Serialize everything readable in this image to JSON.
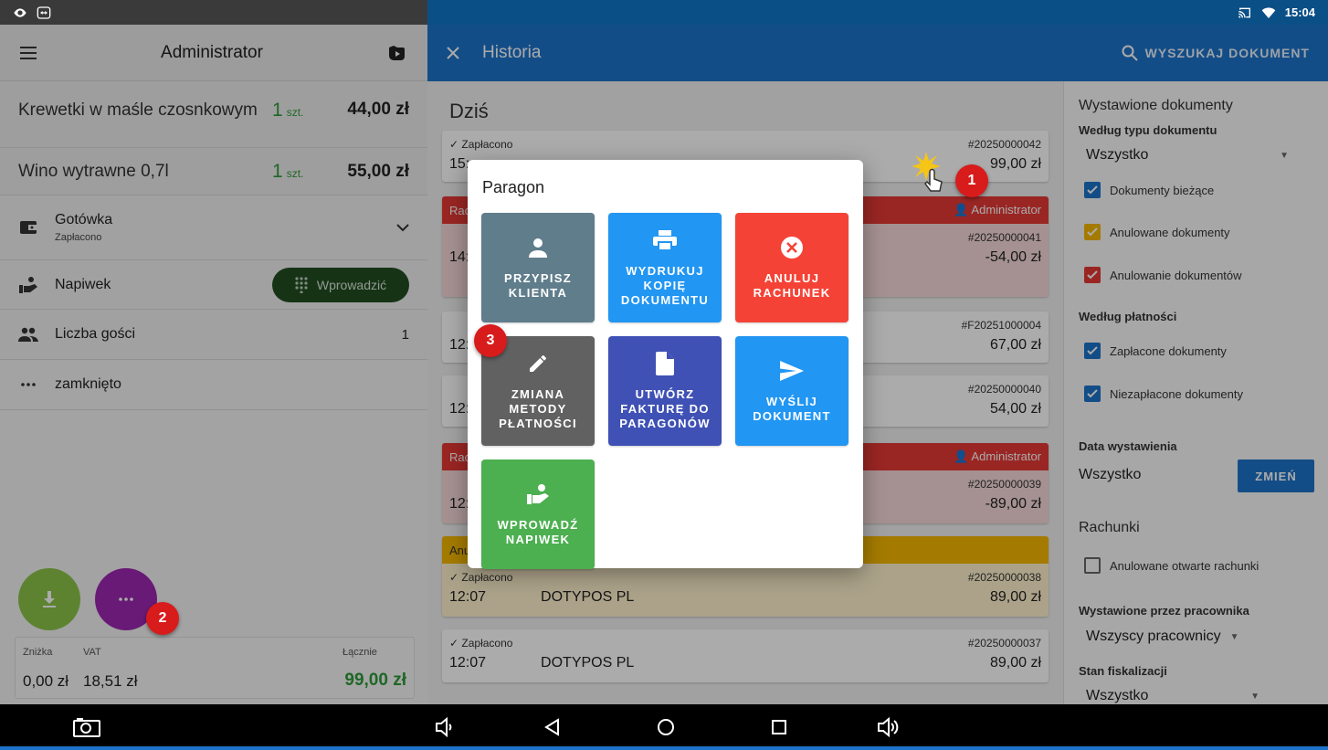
{
  "status_bar": {
    "time": "15:04"
  },
  "left_panel": {
    "title": "Administrator",
    "items": [
      {
        "name": "Krewetki w maśle czosnkowym",
        "qty": "1",
        "unit": "szt.",
        "price": "44,00 zł"
      },
      {
        "name": "Wino wytrawne 0,7l",
        "qty": "1",
        "unit": "szt.",
        "price": "55,00 zł"
      }
    ],
    "payment": {
      "label": "Gotówka",
      "status": "Zapłacono"
    },
    "tip": {
      "label": "Napiwek",
      "button": "Wprowadzić"
    },
    "guests": {
      "label": "Liczba gości",
      "value": "1"
    },
    "closed": {
      "label": "zamknięto"
    },
    "totals": {
      "discount_label": "Zniżka",
      "discount_value": "0,00 zł",
      "vat_label": "VAT",
      "vat_value": "18,51 zł",
      "total_label": "Łącznie",
      "total_value": "99,00 zł"
    }
  },
  "history": {
    "title": "Historia",
    "search_label": "WYSZUKAJ DOKUMENT",
    "day_label": "Dziś",
    "cards": [
      {
        "status": "Zapłacono",
        "number": "#20250000042",
        "time": "15:",
        "amount": "99,00 zł",
        "band": ""
      },
      {
        "band": "Rac",
        "band_user": "Administrator",
        "number": "#20250000041",
        "time": "14:",
        "amount": "-54,00 zł"
      },
      {
        "number": "#F20251000004",
        "time": "12:",
        "amount": "67,00 zł",
        "band": ""
      },
      {
        "number": "#20250000040",
        "time": "12:",
        "amount": "54,00 zł",
        "band": ""
      },
      {
        "band": "Rac",
        "band_user": "Administrator",
        "number": "#20250000039",
        "time": "12:",
        "amount": "-89,00 zł"
      },
      {
        "band": "Anu",
        "status": "Zapłacono",
        "number": "#20250000038",
        "time": "12:07",
        "customer": "DOTYPOS  PL",
        "amount": "89,00 zł"
      },
      {
        "status": "Zapłacono",
        "number": "#20250000037",
        "time": "12:07",
        "customer": "DOTYPOS  PL",
        "amount": "89,00 zł",
        "band": ""
      }
    ]
  },
  "filters": {
    "title": "Wystawione dokumenty",
    "by_type_label": "Według typu dokumentu",
    "by_type_value": "Wszystko",
    "type_checks": [
      {
        "label": "Dokumenty bieżące",
        "color": "#1d73c9"
      },
      {
        "label": "Anulowane dokumenty",
        "color": "#f5b800"
      },
      {
        "label": "Anulowanie dokumentów",
        "color": "#e53935"
      }
    ],
    "by_payment_label": "Według płatności",
    "payment_checks": [
      {
        "label": "Zapłacone dokumenty",
        "color": "#1d73c9"
      },
      {
        "label": "Niezapłacone dokumenty",
        "color": "#1d73c9"
      }
    ],
    "date_label": "Data wystawienia",
    "date_value": "Wszystko",
    "date_button": "ZMIEŃ",
    "bills_label": "Rachunki",
    "bills_check": "Anulowane otwarte rachunki",
    "employee_label": "Wystawione przez pracownika",
    "employee_value": "Wszyscy pracownicy",
    "fiscal_label": "Stan fiskalizacji",
    "fiscal_value": "Wszystko"
  },
  "modal": {
    "title": "Paragon",
    "tiles": [
      {
        "label": "PRZYPISZ KLIENTA",
        "color": "#607d8b",
        "icon": "person-icon"
      },
      {
        "label": "WYDRUKUJ KOPIĘ DOKUMENTU",
        "color": "#2196f3",
        "icon": "printer-icon"
      },
      {
        "label": "ANULUJ RACHUNEK",
        "color": "#f44336",
        "icon": "cancel-icon"
      },
      {
        "label": "ZMIANA METODY PŁATNOŚCI",
        "color": "#616161",
        "icon": "pencil-icon"
      },
      {
        "label": "UTWÓRZ FAKTURĘ DO PARAGONÓW",
        "color": "#3f51b5",
        "icon": "document-icon"
      },
      {
        "label": "WYŚLIJ DOKUMENT",
        "color": "#2196f3",
        "icon": "send-icon"
      },
      {
        "label": "WPROWADŹ NAPIWEK",
        "color": "#4caf50",
        "icon": "tip-hand-icon"
      }
    ]
  },
  "badges": [
    "1",
    "2",
    "3"
  ]
}
